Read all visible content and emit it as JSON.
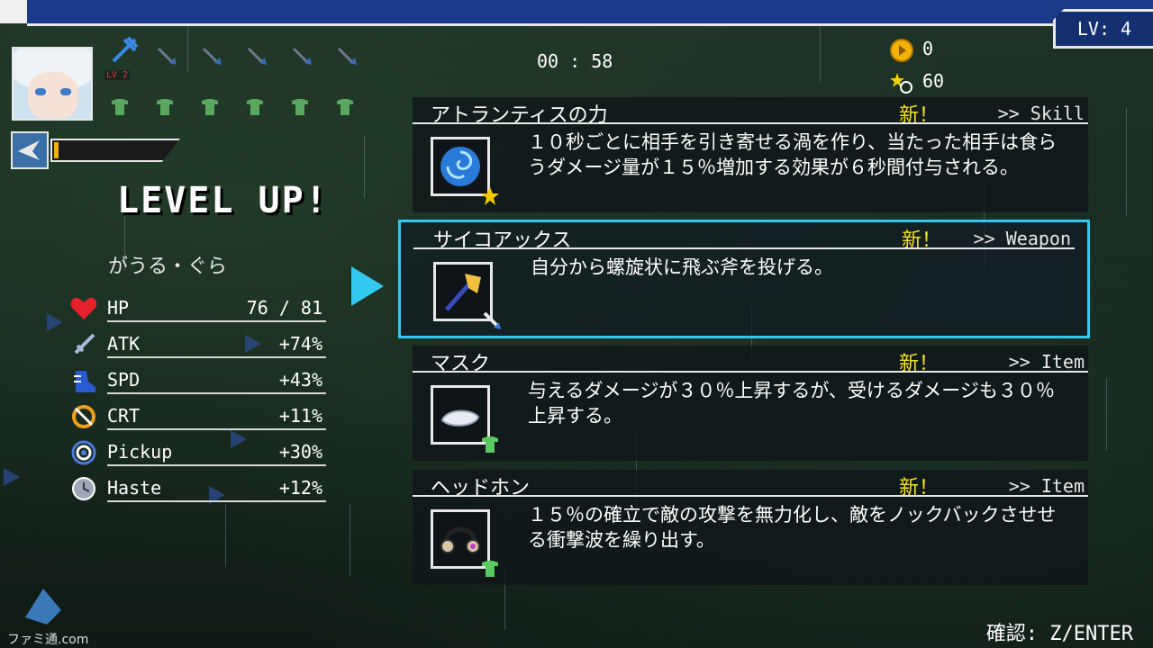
{
  "hud": {
    "level": "LV: 4",
    "timer": "00 : 58",
    "coins": "0",
    "kills": "60",
    "weapon_level": "LV 2"
  },
  "character": {
    "name": "がうる・ぐら",
    "exp_fill": 0.04
  },
  "level_up": "LEVEL UP!",
  "stats": [
    {
      "label": "HP",
      "value": "76 / 81",
      "icon": "heart-icon",
      "color": "#e8202c"
    },
    {
      "label": "ATK",
      "value": "+74%",
      "icon": "sword-icon",
      "color": "#8aa0c8"
    },
    {
      "label": "SPD",
      "value": "+43%",
      "icon": "boot-icon",
      "color": "#2a5ad0"
    },
    {
      "label": "CRT",
      "value": "+11%",
      "icon": "crit-icon",
      "color": "#f0a020"
    },
    {
      "label": "Pickup",
      "value": "+30%",
      "icon": "magnet-icon",
      "color": "#4a7ae0"
    },
    {
      "label": "Haste",
      "value": "+12%",
      "icon": "clock-icon",
      "color": "#a0a8b8"
    }
  ],
  "choices": [
    {
      "name": "アトランティスの力",
      "new": "新！",
      "type": ">> Skill",
      "desc": "１０秒ごとに相手を引き寄せる渦を作り、当たった相手は食らうダメージ量が１５％増加する効果が６秒間付与される。",
      "icon": "whirlpool-icon",
      "badge": "star-badge-icon"
    },
    {
      "name": "サイコアックス",
      "new": "新！",
      "type": ">> Weapon",
      "desc": "自分から螺旋状に飛ぶ斧を投げる。",
      "icon": "axe-icon",
      "badge": "weapon-badge-icon"
    },
    {
      "name": "マスク",
      "new": "新！",
      "type": ">> Item",
      "desc": "与えるダメージが３０％上昇するが、受けるダメージも３０％上昇する。",
      "icon": "mask-icon",
      "badge": "item-badge-icon"
    },
    {
      "name": "ヘッドホン",
      "new": "新！",
      "type": ">> Item",
      "desc": "１５％の確立で敵の攻撃を無力化し、敵をノックバックさせせる衝撃波を繰り出す。",
      "icon": "headphones-icon",
      "badge": "item-badge-icon"
    }
  ],
  "confirm_hint": "確認: Z/ENTER",
  "watermark": "ファミ通.com",
  "colors": {
    "accent": "#33c8f0",
    "new_label": "#f4e21c",
    "top_bar": "#1a3a8a"
  }
}
